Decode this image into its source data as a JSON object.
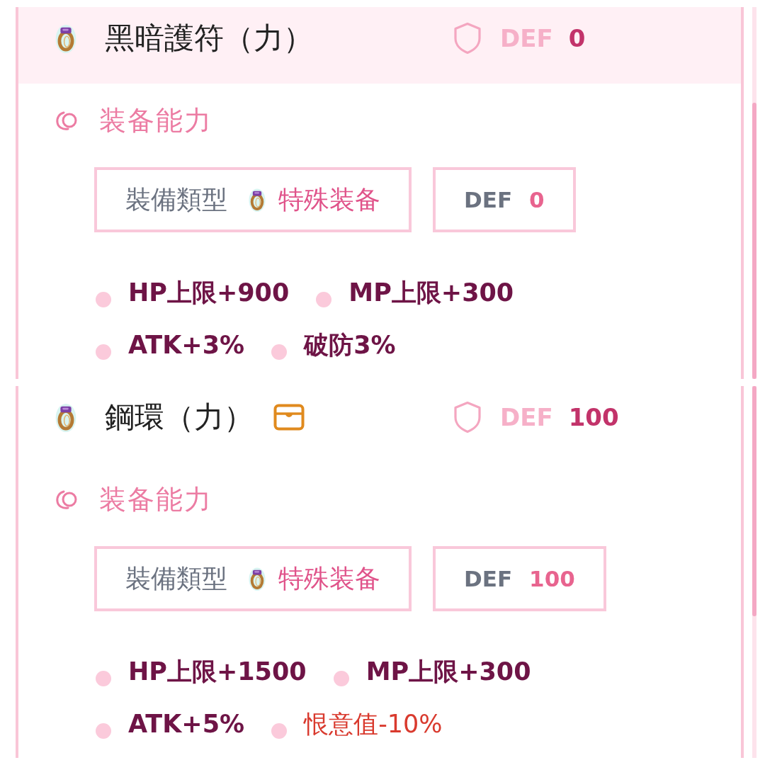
{
  "cards": [
    {
      "highlighted": true,
      "title": "黑暗護符（力）",
      "chest_mark": false,
      "def": {
        "label": "DEF",
        "value": "0"
      },
      "section_title": "装备能力",
      "type_box": {
        "label": "裝備類型",
        "value": "特殊装备"
      },
      "def_box": {
        "label": "DEF",
        "value": "0"
      },
      "stats": [
        {
          "text": "HP上限+900",
          "kind": "normal"
        },
        {
          "text": "MP上限+300",
          "kind": "normal"
        },
        {
          "text": "ATK+3%",
          "kind": "normal"
        },
        {
          "text": "破防3%",
          "kind": "normal"
        }
      ]
    },
    {
      "highlighted": false,
      "title": "鋼環（力）",
      "chest_mark": true,
      "def": {
        "label": "DEF",
        "value": "100"
      },
      "section_title": "装备能力",
      "type_box": {
        "label": "裝備類型",
        "value": "特殊装备"
      },
      "def_box": {
        "label": "DEF",
        "value": "100"
      },
      "stats": [
        {
          "text": "HP上限+1500",
          "kind": "normal"
        },
        {
          "text": "MP上限+300",
          "kind": "normal"
        },
        {
          "text": "ATK+5%",
          "kind": "normal"
        },
        {
          "text": "恨意值-10%",
          "kind": "special"
        }
      ]
    }
  ]
}
